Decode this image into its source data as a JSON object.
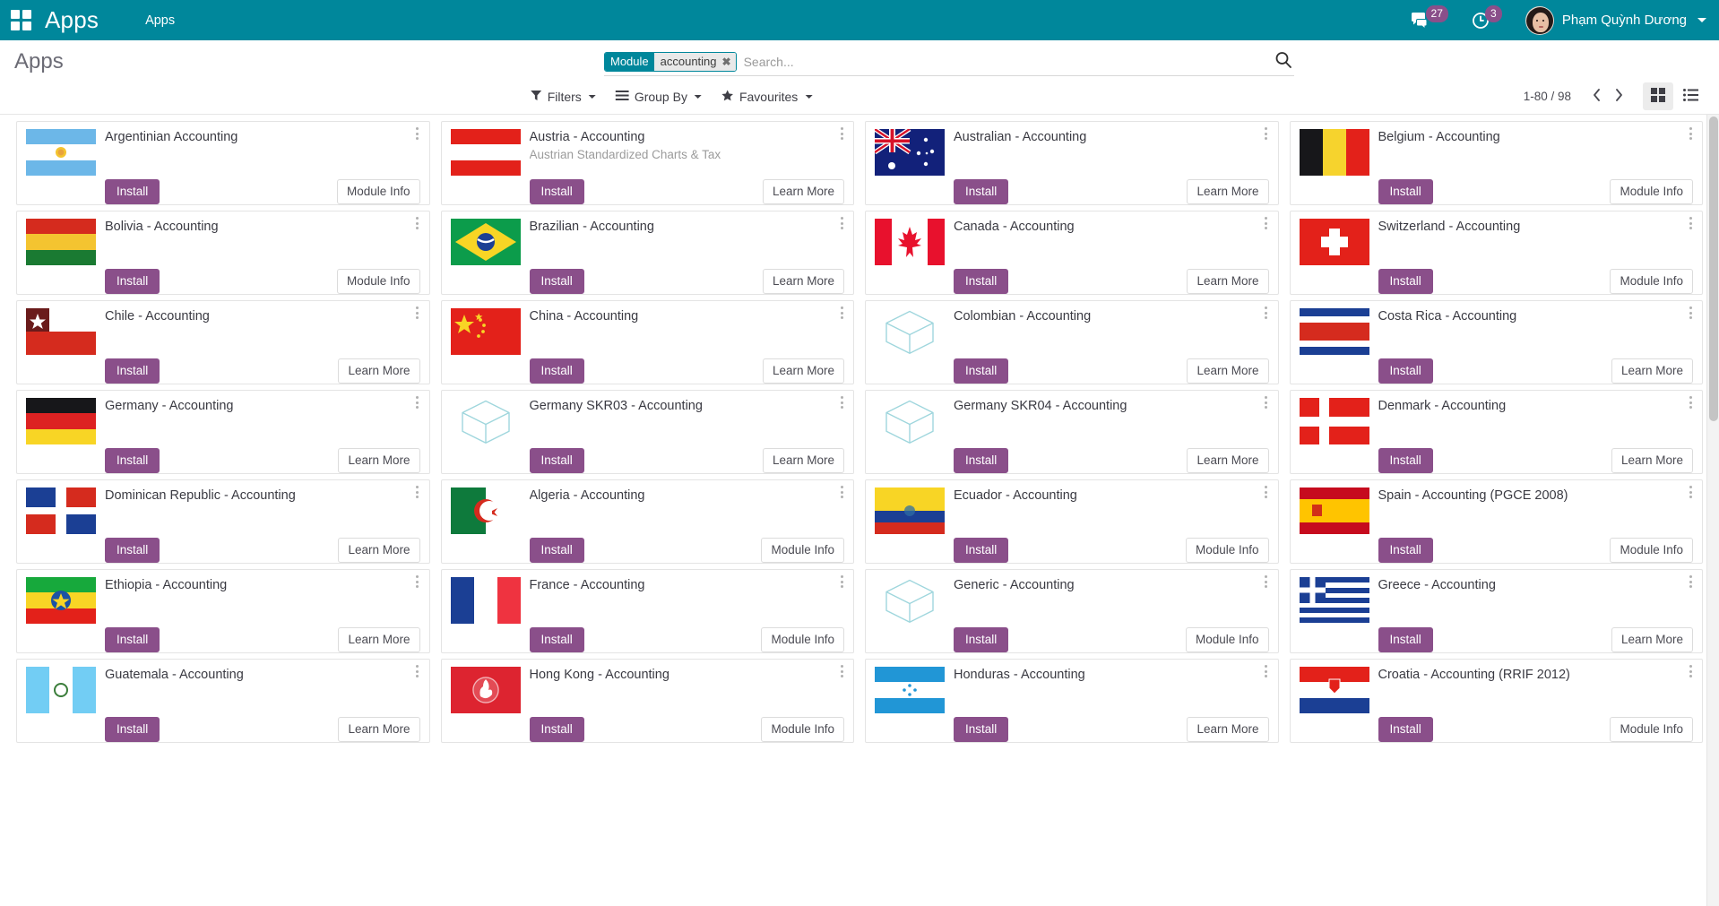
{
  "navbar": {
    "apps_icon": "apps-grid-icon",
    "brand": "Apps",
    "menu_item": "Apps",
    "messages_icon": "chat-bubble-icon",
    "messages_count": "27",
    "activities_icon": "clock-icon",
    "activities_count": "3",
    "user_name": "Phạm Quỳnh Dương",
    "avatar_icon": "avatar",
    "caret_icon": "chevron-down-icon"
  },
  "control_panel": {
    "breadcrumb": "Apps",
    "search": {
      "facet_label": "Module",
      "facet_value": "accounting",
      "facet_remove_icon": "close-icon",
      "placeholder": "Search...",
      "value": "",
      "search_icon": "search-icon"
    },
    "filters_label": "Filters",
    "filters_icon": "filter-icon",
    "groupby_label": "Group By",
    "groupby_icon": "list-icon",
    "favourites_label": "Favourites",
    "favourites_icon": "star-icon",
    "pager": "1-80 / 98",
    "prev_icon": "chevron-left-icon",
    "next_icon": "chevron-right-icon",
    "kanban_view_icon": "kanban-view-icon",
    "list_view_icon": "list-view-icon",
    "active_view": "kanban"
  },
  "buttons": {
    "install": "Install",
    "module_info": "Module Info",
    "learn_more": "Learn More"
  },
  "apps": [
    {
      "title": "Argentinian Accounting",
      "subtitle": "",
      "icon": "flag-argentina",
      "secondary": "Module Info"
    },
    {
      "title": "Austria - Accounting",
      "subtitle": "Austrian Standardized Charts & Tax",
      "icon": "flag-austria",
      "secondary": "Learn More"
    },
    {
      "title": "Australian - Accounting",
      "subtitle": "",
      "icon": "flag-australia",
      "secondary": "Learn More"
    },
    {
      "title": "Belgium - Accounting",
      "subtitle": "",
      "icon": "flag-belgium",
      "secondary": "Module Info"
    },
    {
      "title": "Bolivia - Accounting",
      "subtitle": "",
      "icon": "flag-bolivia",
      "secondary": "Module Info"
    },
    {
      "title": "Brazilian - Accounting",
      "subtitle": "",
      "icon": "flag-brazil",
      "secondary": "Learn More"
    },
    {
      "title": "Canada - Accounting",
      "subtitle": "",
      "icon": "flag-canada",
      "secondary": "Learn More"
    },
    {
      "title": "Switzerland - Accounting",
      "subtitle": "",
      "icon": "flag-switzerland",
      "secondary": "Module Info"
    },
    {
      "title": "Chile - Accounting",
      "subtitle": "",
      "icon": "flag-chile",
      "secondary": "Learn More"
    },
    {
      "title": "China - Accounting",
      "subtitle": "",
      "icon": "flag-china",
      "secondary": "Learn More"
    },
    {
      "title": "Colombian - Accounting",
      "subtitle": "",
      "icon": "generic-cube",
      "secondary": "Learn More"
    },
    {
      "title": "Costa Rica - Accounting",
      "subtitle": "",
      "icon": "flag-costarica",
      "secondary": "Learn More"
    },
    {
      "title": "Germany - Accounting",
      "subtitle": "",
      "icon": "flag-germany",
      "secondary": "Learn More"
    },
    {
      "title": "Germany SKR03 - Accounting",
      "subtitle": "",
      "icon": "generic-cube",
      "secondary": "Learn More"
    },
    {
      "title": "Germany SKR04 - Accounting",
      "subtitle": "",
      "icon": "generic-cube",
      "secondary": "Learn More"
    },
    {
      "title": "Denmark - Accounting",
      "subtitle": "",
      "icon": "flag-denmark",
      "secondary": "Learn More"
    },
    {
      "title": "Dominican Republic - Accounting",
      "subtitle": "",
      "icon": "flag-dominican",
      "secondary": "Learn More"
    },
    {
      "title": "Algeria - Accounting",
      "subtitle": "",
      "icon": "flag-algeria",
      "secondary": "Module Info"
    },
    {
      "title": "Ecuador - Accounting",
      "subtitle": "",
      "icon": "flag-ecuador",
      "secondary": "Module Info"
    },
    {
      "title": "Spain - Accounting (PGCE 2008)",
      "subtitle": "",
      "icon": "flag-spain",
      "secondary": "Module Info"
    },
    {
      "title": "Ethiopia - Accounting",
      "subtitle": "",
      "icon": "flag-ethiopia",
      "secondary": "Learn More"
    },
    {
      "title": "France - Accounting",
      "subtitle": "",
      "icon": "flag-france",
      "secondary": "Module Info"
    },
    {
      "title": "Generic - Accounting",
      "subtitle": "",
      "icon": "generic-cube",
      "secondary": "Module Info"
    },
    {
      "title": "Greece - Accounting",
      "subtitle": "",
      "icon": "flag-greece",
      "secondary": "Learn More"
    },
    {
      "title": "Guatemala - Accounting",
      "subtitle": "",
      "icon": "flag-guatemala",
      "secondary": "Learn More"
    },
    {
      "title": "Hong Kong - Accounting",
      "subtitle": "",
      "icon": "flag-hongkong",
      "secondary": "Module Info"
    },
    {
      "title": "Honduras - Accounting",
      "subtitle": "",
      "icon": "flag-honduras",
      "secondary": "Learn More"
    },
    {
      "title": "Croatia - Accounting (RRIF 2012)",
      "subtitle": "",
      "icon": "flag-croatia",
      "secondary": "Module Info"
    }
  ],
  "colors": {
    "brand_teal": "#00879b",
    "install_purple": "#8a4f8a",
    "badge_purple": "#8a4f8a",
    "text_dark": "#3a3a42",
    "text_muted": "#9b9b9b"
  }
}
